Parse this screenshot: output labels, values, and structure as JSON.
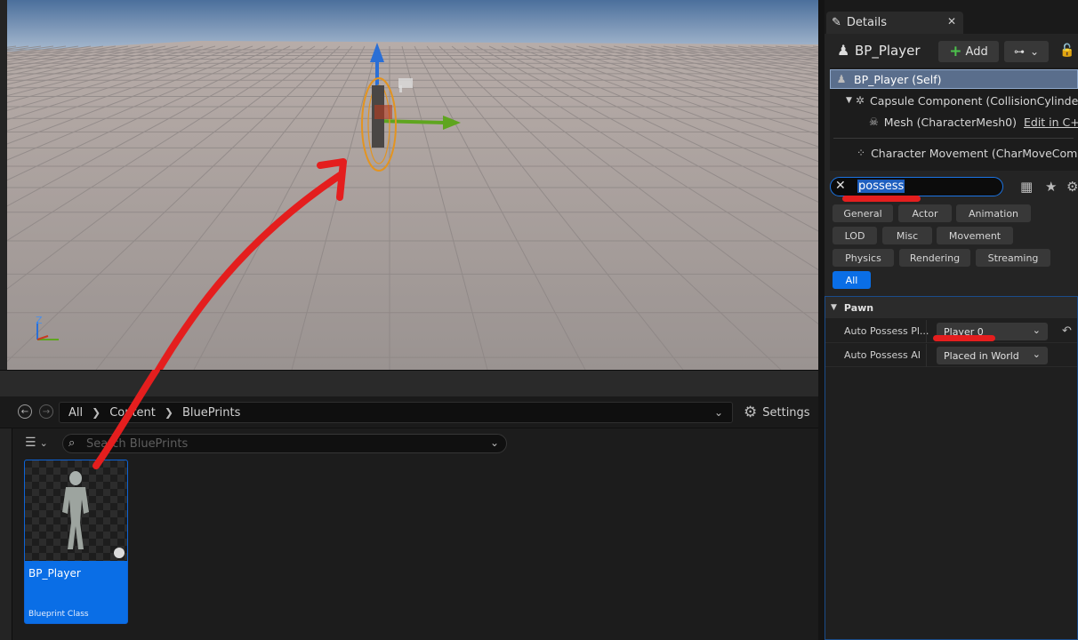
{
  "viewport": {
    "axis_labels": {
      "z": "Z",
      "x": "X",
      "y": "Y"
    }
  },
  "content_browser": {
    "nav_back": "←",
    "nav_forward": "→",
    "breadcrumbs": [
      "All",
      "Content",
      "BluePrints"
    ],
    "settings_label": "Settings",
    "search_placeholder": "Search BluePrints",
    "asset": {
      "name": "BP_Player",
      "type": "Blueprint Class"
    }
  },
  "details": {
    "tab_label": "Details",
    "actor_name": "BP_Player",
    "add_label": "Add",
    "components": [
      {
        "label": "BP_Player (Self)",
        "selected": true
      },
      {
        "label": "Capsule Component (CollisionCylinder)"
      },
      {
        "label": "Mesh (CharacterMesh0)",
        "link": "Edit in C++"
      },
      {
        "label": "Character Movement (CharMoveComp"
      }
    ],
    "search_value": "possess",
    "filters": [
      "General",
      "Actor",
      "Animation",
      "LOD",
      "Misc",
      "Movement",
      "Physics",
      "Rendering",
      "Streaming",
      "All"
    ],
    "active_filter": "All",
    "section": "Pawn",
    "properties": [
      {
        "label": "Auto Possess Pl...",
        "value": "Player 0"
      },
      {
        "label": "Auto Possess AI",
        "value": "Placed in World"
      }
    ]
  },
  "colors": {
    "accent": "#0a6ee6",
    "annotation": "#e41e1e",
    "panel": "#242424"
  }
}
